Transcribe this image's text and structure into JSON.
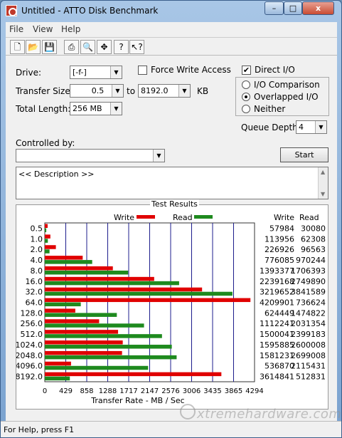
{
  "window": {
    "title": "Untitled - ATTO Disk Benchmark",
    "btn_min": "–",
    "btn_max": "□",
    "btn_close": "x"
  },
  "menu": {
    "file": "File",
    "view": "View",
    "help": "Help"
  },
  "toolbar": [
    "new-icon",
    "open-icon",
    "save-icon",
    "print-icon",
    "print-preview-icon",
    "move-icon",
    "help-icon",
    "context-help-icon"
  ],
  "form": {
    "drive_label": "Drive:",
    "drive_value": "[-f-]",
    "force_write_label": "Force Write Access",
    "direct_io_label": "Direct I/O",
    "direct_io_checked": "✔",
    "transfer_size_label": "Transfer Size:",
    "transfer_from": "0.5",
    "to_label": "to",
    "transfer_to": "8192.0",
    "kb_label": "KB",
    "total_length_label": "Total Length:",
    "total_length_value": "256 MB",
    "io_comparison_label": "I/O Comparison",
    "overlapped_io_label": "Overlapped I/O",
    "neither_label": "Neither",
    "queue_depth_label": "Queue Depth:",
    "queue_depth_value": "4",
    "controlled_by_label": "Controlled by:",
    "controlled_by_value": "",
    "start_label": "Start",
    "description_text": "<< Description >>"
  },
  "results": {
    "group_label": "Test Results",
    "write_header": "Write",
    "read_header": "Read",
    "rows": [
      {
        "size": "0.5",
        "write": "57984",
        "read": "30080"
      },
      {
        "size": "1.0",
        "write": "113956",
        "read": "62308"
      },
      {
        "size": "2.0",
        "write": "226926",
        "read": "96563"
      },
      {
        "size": "4.0",
        "write": "776085",
        "read": "970244"
      },
      {
        "size": "8.0",
        "write": "1393377",
        "read": "1706393"
      },
      {
        "size": "16.0",
        "write": "2239168",
        "read": "2749890"
      },
      {
        "size": "32.0",
        "write": "3219652",
        "read": "3841589"
      },
      {
        "size": "64.0",
        "write": "4209901",
        "read": "736624"
      },
      {
        "size": "128.0",
        "write": "624449",
        "read": "1474822"
      },
      {
        "size": "256.0",
        "write": "1112241",
        "read": "2031354"
      },
      {
        "size": "512.0",
        "write": "1500041",
        "read": "2399183"
      },
      {
        "size": "1024.0",
        "write": "1595885",
        "read": "2600008"
      },
      {
        "size": "2048.0",
        "write": "1581231",
        "read": "2699008"
      },
      {
        "size": "4096.0",
        "write": "536870",
        "read": "2115431"
      },
      {
        "size": "8192.0",
        "write": "3614841",
        "read": "512831"
      }
    ]
  },
  "chart_data": {
    "type": "bar",
    "categories": [
      "0.5",
      "1.0",
      "2.0",
      "4.0",
      "8.0",
      "16.0",
      "32.0",
      "64.0",
      "128.0",
      "256.0",
      "512.0",
      "1024.0",
      "2048.0",
      "4096.0",
      "8192.0"
    ],
    "series": [
      {
        "name": "Write",
        "values": [
          57984,
          113956,
          226926,
          776085,
          1393377,
          2239168,
          3219652,
          4209901,
          624449,
          1112241,
          1500041,
          1595885,
          1581231,
          536870,
          3614841
        ]
      },
      {
        "name": "Read",
        "values": [
          30080,
          62308,
          96563,
          970244,
          1706393,
          2749890,
          3841589,
          736624,
          1474822,
          2031354,
          2399183,
          2600008,
          2699008,
          2115431,
          512831
        ]
      }
    ],
    "x_ticks": [
      "0",
      "429",
      "858",
      "1288",
      "1717",
      "2147",
      "2576",
      "3006",
      "3435",
      "3865",
      "4294"
    ],
    "xlim": [
      0,
      4294
    ],
    "xlabel": "Transfer Rate - MB / Sec",
    "colors": {
      "write": "#e00000",
      "read": "#1e8a1e",
      "grid": "#1c1c8c"
    },
    "legend_position": "top"
  },
  "status": {
    "text": "For Help, press F1"
  },
  "watermark": {
    "text": "xtremehardware.com"
  }
}
